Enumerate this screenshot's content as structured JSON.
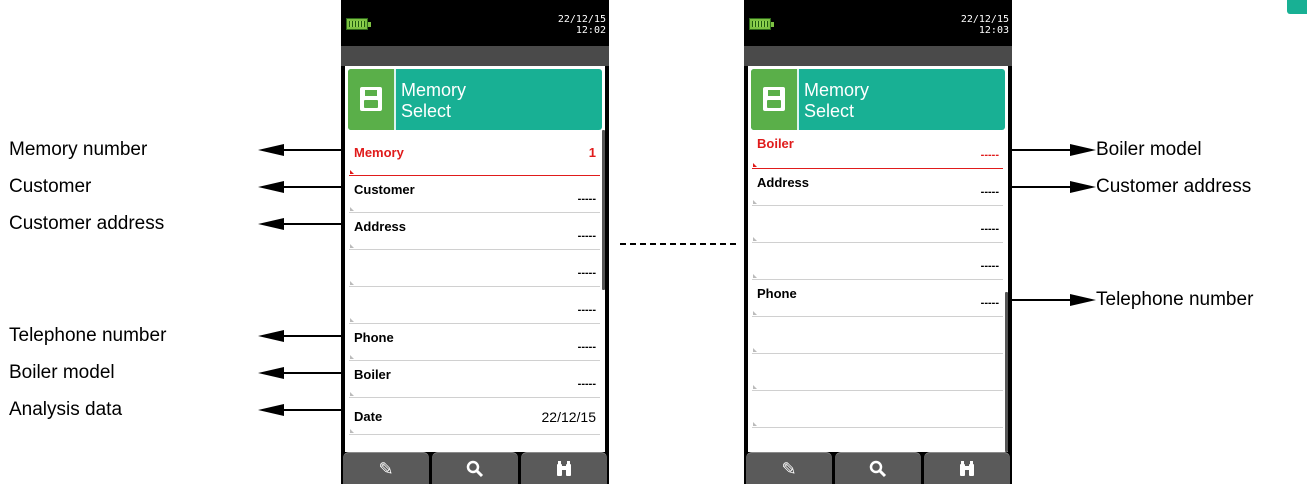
{
  "left_labels": [
    "Memory number",
    "Customer",
    "Customer address",
    "Telephone number",
    "Boiler model",
    "Analysis data"
  ],
  "right_labels": [
    "Boiler model",
    "Customer address",
    "Telephone number"
  ],
  "device_left": {
    "date": "22/12/15",
    "time": "12:02",
    "title_line1": "Memory",
    "title_line2": "Select",
    "rows": [
      {
        "label": "Memory",
        "value": "1",
        "active": true
      },
      {
        "label": "Customer",
        "value": "-----"
      },
      {
        "label": "Address",
        "value": "-----"
      },
      {
        "label": "",
        "value": "-----"
      },
      {
        "label": "",
        "value": "-----"
      },
      {
        "label": "Phone",
        "value": "-----"
      },
      {
        "label": "Boiler",
        "value": "-----"
      },
      {
        "label": "Date",
        "value": "22/12/15"
      }
    ]
  },
  "device_right": {
    "date": "22/12/15",
    "time": "12:03",
    "title_line1": "Memory",
    "title_line2": "Select",
    "rows": [
      {
        "label": "Boiler",
        "value": "-----",
        "active": true
      },
      {
        "label": "Address",
        "value": "-----"
      },
      {
        "label": "",
        "value": "-----"
      },
      {
        "label": "",
        "value": "-----"
      },
      {
        "label": "Phone",
        "value": "-----"
      },
      {
        "label": "",
        "value": ""
      },
      {
        "label": "",
        "value": ""
      },
      {
        "label": "",
        "value": ""
      }
    ]
  },
  "softkeys": [
    {
      "icon": "pencil-icon",
      "glyph": "✎"
    },
    {
      "icon": "magnifier-icon",
      "glyph": "🔍"
    },
    {
      "icon": "binoculars-icon",
      "glyph": "⛘"
    }
  ],
  "colors": {
    "header_teal": "#18b094",
    "header_green": "#5aaf49",
    "active_red": "#e01b1b",
    "battery_green": "#7dc142",
    "softkey_gray": "#5a5a5a"
  }
}
